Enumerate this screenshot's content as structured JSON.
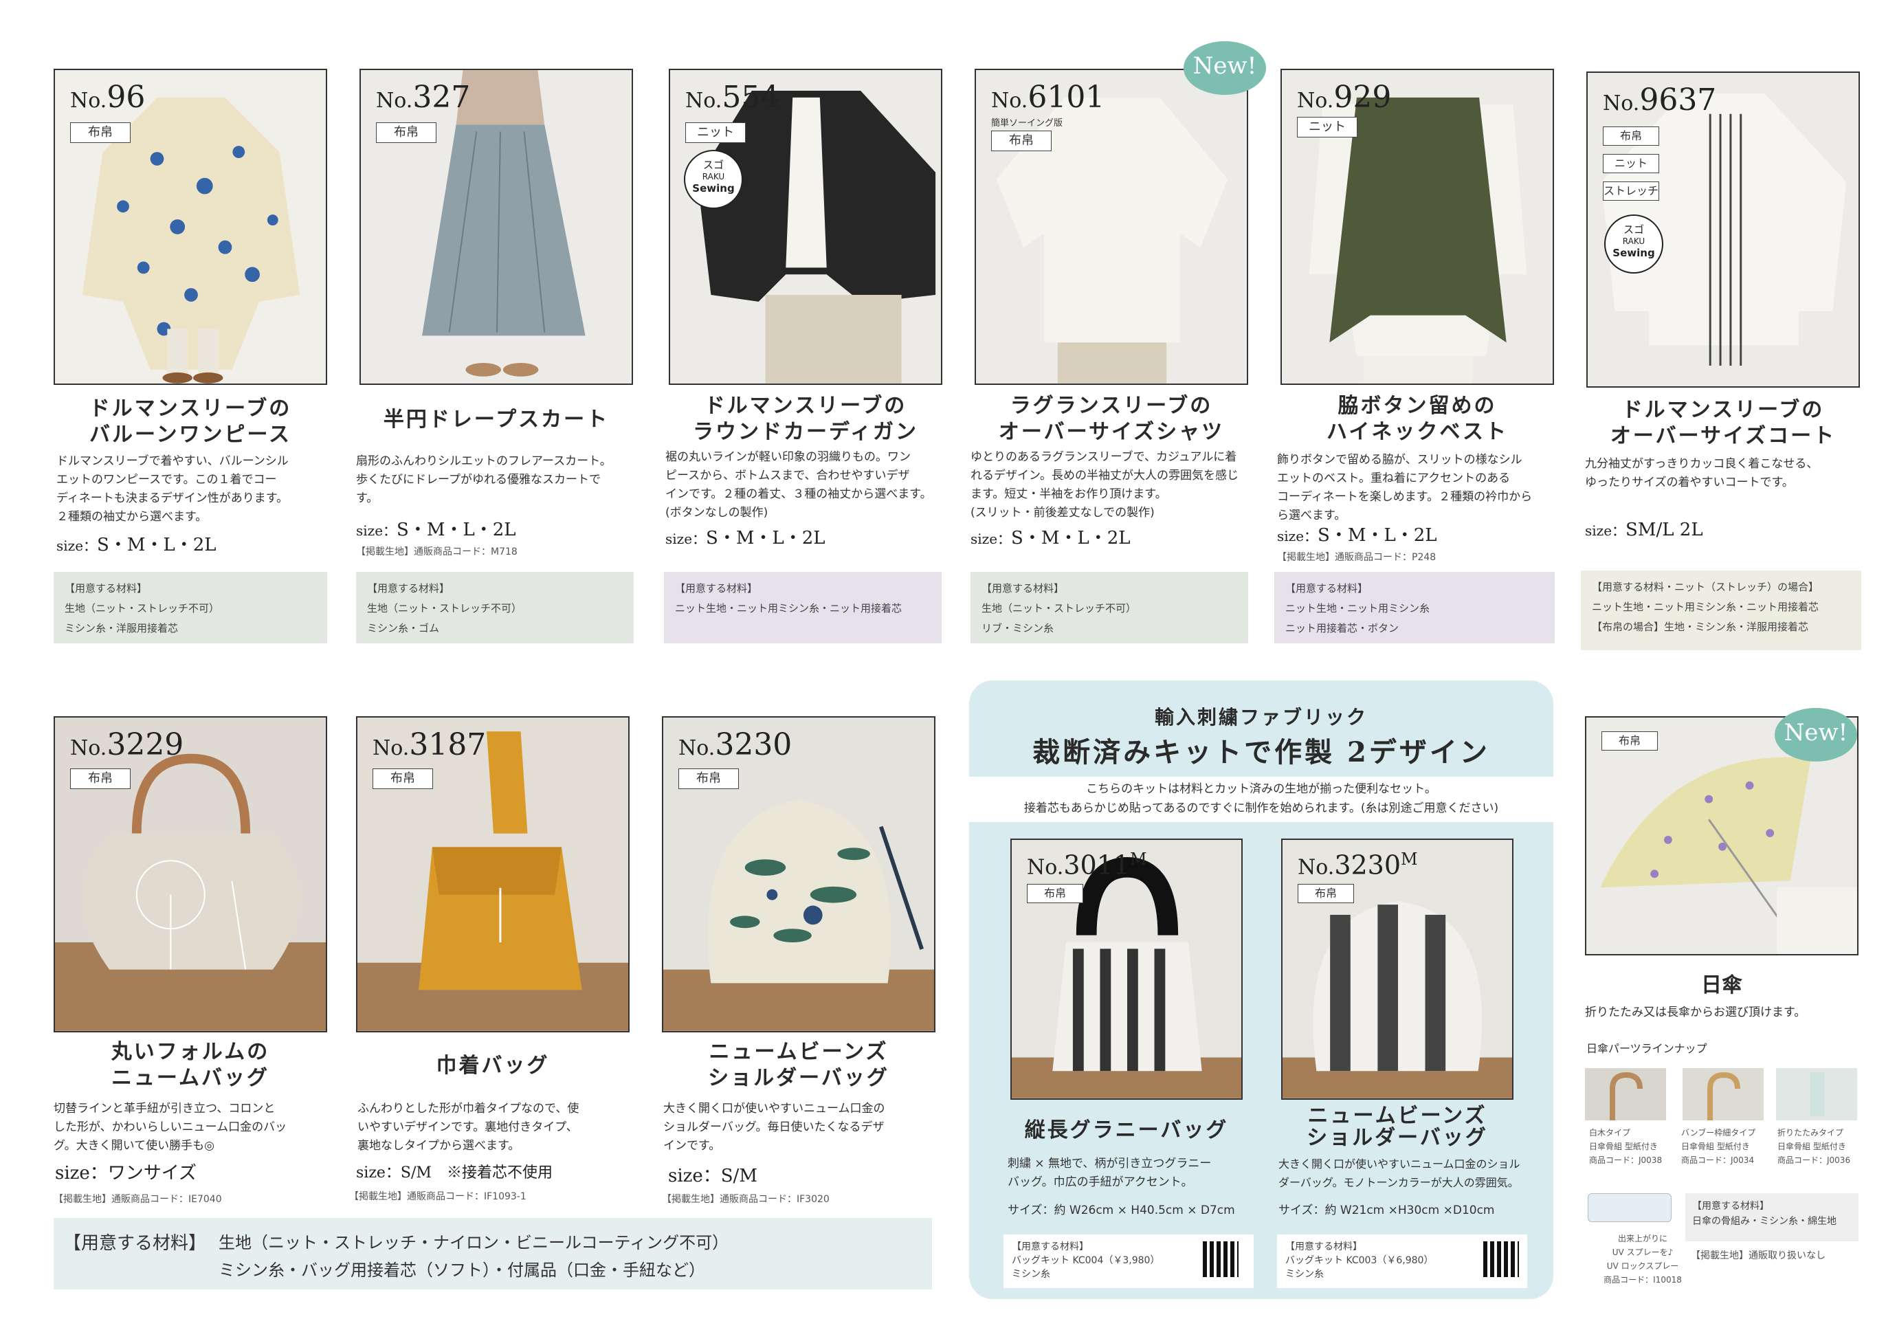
{
  "products_top": [
    {
      "no": "96",
      "tags": [
        "布帛"
      ],
      "title": [
        "ドルマンスリーブの",
        "バルーンワンピース"
      ],
      "desc": [
        "ドルマンスリーブで着やすい、バルーンシル",
        "エットのワンピースです。この１着でコー",
        "ディネートも決まるデザイン性があります。",
        "２種類の袖丈から選べます。"
      ],
      "size": "S・M・L・2L",
      "code": "",
      "materials": [
        "【用意する材料】",
        "生地（ニット・ストレッチ不可）",
        "ミシン糸・洋服用接着芯"
      ]
    },
    {
      "no": "327",
      "tags": [
        "布帛"
      ],
      "title": [
        "半円ドレープスカート"
      ],
      "desc": [
        "扇形のふんわりシルエットのフレアースカート。",
        "歩くたびにドレープがゆれる優雅なスカートで",
        "す。"
      ],
      "size": "S・M・L・2L",
      "code": "【掲載生地】通販商品コード：M718",
      "materials": [
        "【用意する材料】",
        "生地（ニット・ストレッチ不可）",
        "ミシン糸・ゴム"
      ]
    },
    {
      "no": "554",
      "tags": [
        "ニット"
      ],
      "title": [
        "ドルマンスリーブの",
        "ラウンドカーディガン"
      ],
      "desc": [
        "裾の丸いラインが軽い印象の羽織りもの。ワン",
        "ピースから、ボトムスまで、合わせやすいデザ",
        "インです。２種の着丈、３種の袖丈から選べます。",
        "(ボタンなしの製作)"
      ],
      "size": "S・M・L・2L",
      "code": "",
      "materials": [
        "【用意する材料】",
        "ニット生地・ニット用ミシン糸・ニット用接着芯"
      ]
    },
    {
      "no": "6101",
      "sub": "簡単ソーイング版",
      "tags": [
        "布帛"
      ],
      "title": [
        "ラグランスリーブの",
        "オーバーサイズシャツ"
      ],
      "desc": [
        "ゆとりのあるラグランスリーブで、カジュアルに着",
        "れるデザイン。長めの半袖丈が大人の雰囲気を感じ",
        "ます。短丈・半袖をお作り頂けます。",
        "(スリット・前後差丈なしでの製作)"
      ],
      "size": "S・M・L・2L",
      "code": "",
      "materials": [
        "【用意する材料】",
        "生地（ニット・ストレッチ不可）",
        "リブ・ミシン糸"
      ]
    },
    {
      "no": "929",
      "tags": [
        "ニット"
      ],
      "title": [
        "脇ボタン留めの",
        "ハイネックベスト"
      ],
      "desc": [
        "飾りボタンで留める脇が、スリットの様なシル",
        "エットのベスト。重ね着にアクセントのある",
        "コーディネートを楽しめます。２種類の衿巾から",
        "ら選べます。"
      ],
      "size": "S・M・L・2L",
      "code": "【掲載生地】通販商品コード：P248",
      "materials": [
        "【用意する材料】",
        "ニット生地・ニット用ミシン糸",
        "ニット用接着芯・ボタン"
      ]
    },
    {
      "no": "9637",
      "tags": [
        "布帛",
        "ニット",
        "ストレッチ"
      ],
      "title": [
        "ドルマンスリーブの",
        "オーバーサイズコート"
      ],
      "desc": [
        "九分袖丈がすっきりカッコ良く着こなせる、",
        "ゆったりサイズの着やすいコートです。"
      ],
      "size": "SM/L 2L",
      "code": "",
      "materials": [
        "【用意する材料・ニット（ストレッチ）の場合】",
        "ニット生地・ニット用ミシン糸・ニット用接着芯",
        "【布帛の場合】生地・ミシン糸・洋服用接着芯"
      ]
    }
  ],
  "labels": {
    "size": "size：",
    "new": "New!",
    "raku_top": "スゴ",
    "raku_mid": "RAKU",
    "raku_bot": "Sewing"
  },
  "bags": [
    {
      "no": "3229",
      "tag": "布帛",
      "title": [
        "丸いフォルムの",
        "ニュームバッグ"
      ],
      "desc": [
        "切替ラインと革手紐が引き立つ、コロンと",
        "した形が、かわいらしいニューム口金のバッ",
        "グ。大きく開いて使い勝手も◎"
      ],
      "size": "size：ワンサイズ",
      "code": "【掲載生地】通販商品コード：IE7040"
    },
    {
      "no": "3187",
      "tag": "布帛",
      "title": [
        "巾着バッグ"
      ],
      "desc": [
        "ふんわりとした形が巾着タイプなので、使",
        "いやすいデザインです。裏地付きタイプ、",
        "裏地なしタイプから選べます。"
      ],
      "size": "size：S/M　※接着芯不使用",
      "code": "【掲載生地】通販商品コード：IF1093-1"
    },
    {
      "no": "3230",
      "tag": "布帛",
      "title": [
        "ニュームビーンズ",
        "ショルダーバッグ"
      ],
      "desc": [
        "大きく開く口が使いやすいニューム口金の",
        "ショルダーバッグ。毎日使いたくなるデザ",
        "インです。"
      ],
      "size": "size：S/M",
      "code": "【掲載生地】通販商品コード：IF3020"
    }
  ],
  "bag_materials": {
    "label": "【用意する材料】",
    "line1": "生地（ニット・ストレッチ・ナイロン・ビニールコーティング不可）",
    "line2": "ミシン糸・バッグ用接着芯（ソフト）・付属品（口金・手紐など）"
  },
  "kit": {
    "heading1": "輸入刺繍ファブリック",
    "heading2": "裁断済みキットで作製 2デザイン",
    "intro1": "こちらのキットは材料とカット済みの生地が揃った便利なセット。",
    "intro2": "接着芯もあらかじめ貼ってあるのですぐに制作を始められます。(糸は別途ご用意ください)",
    "items": [
      {
        "no": "3011",
        "suffix": "M",
        "tag": "布帛",
        "title": [
          "縦長グラニーバッグ"
        ],
        "desc": [
          "刺繍 × 無地で、柄が引き立つグラニー",
          "バッグ。巾広の手紐がアクセント。"
        ],
        "size": "サイズ：約 W26cm × H40.5cm × D7cm",
        "materials": [
          "【用意する材料】",
          "バッグキット KC004（￥3,980）",
          "ミシン糸"
        ]
      },
      {
        "no": "3230",
        "suffix": "M",
        "tag": "布帛",
        "title": [
          "ニュームビーンズ",
          "ショルダーバッグ"
        ],
        "desc": [
          "大きく開く口が使いやすいニューム口金のショル",
          "ダーバッグ。モノトーンカラーが大人の雰囲気。"
        ],
        "size": "サイズ：約 W21cm ×H30cm ×D10cm",
        "materials": [
          "【用意する材料】",
          "バッグキット KC003（￥6,980）",
          "ミシン糸"
        ]
      }
    ]
  },
  "umbrella": {
    "tag": "布帛",
    "title": "日傘",
    "desc": "折りたたみ又は長傘からお選び頂けます。",
    "parts_heading": "日傘パーツラインナップ",
    "parts": [
      {
        "name": "白木タイプ",
        "l2": "日傘骨組 型紙付き",
        "l3": "商品コード：J0038"
      },
      {
        "name": "バンブー枠細タイプ",
        "l2": "日傘骨組 型紙付き",
        "l3": "商品コード：J0034"
      },
      {
        "name": "折りたたみタイプ",
        "l2": "日傘骨組 型紙付き",
        "l3": "商品コード：J0036"
      }
    ],
    "spray": {
      "l1": "出来上がりに",
      "l2": "UV スプレーを♪",
      "l3": "UV ロックスプレー",
      "l4": "商品コード：I10018"
    },
    "materials": [
      "【用意する材料】",
      "日傘の骨組み・ミシン糸・綿生地"
    ],
    "fabric_note": "【掲載生地】通販取り扱いなし"
  }
}
